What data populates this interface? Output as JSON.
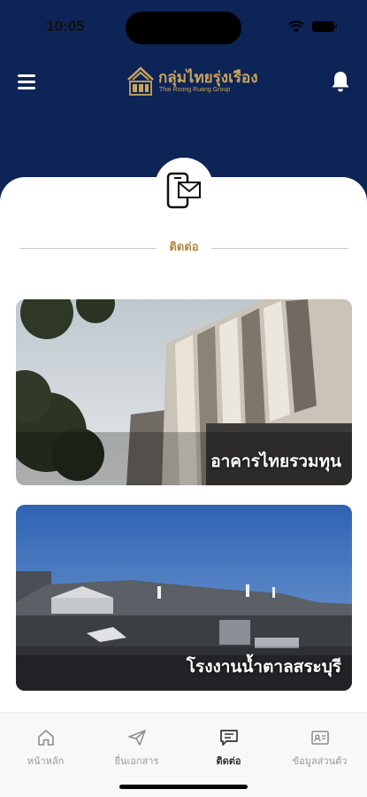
{
  "status_bar": {
    "time": "10:05"
  },
  "header": {
    "logo_title": "กลุ่มไทยรุ่งเรือง",
    "logo_subtitle": "Thai Roong Ruang Group",
    "menu_icon": "hamburger-icon",
    "notification_icon": "bell-icon"
  },
  "section": {
    "title": "ติดต่อ",
    "icon": "phone-mail-icon"
  },
  "cards": [
    {
      "label": "อาคารไทยรวมทุน"
    },
    {
      "label": "โรงงานน้ำตาลสระบุรี"
    }
  ],
  "tabbar": {
    "items": [
      {
        "label": "หน้าหลัก",
        "icon": "home-icon",
        "active": false
      },
      {
        "label": "ยื่นเอกสาร",
        "icon": "send-icon",
        "active": false
      },
      {
        "label": "ติดต่อ",
        "icon": "message-icon",
        "active": true
      },
      {
        "label": "ข้อมูลส่วนตัว",
        "icon": "id-card-icon",
        "active": false
      }
    ]
  },
  "colors": {
    "header_bg": "#0d2456",
    "gold": "#c9a55b",
    "accent_text": "#b08a47"
  }
}
